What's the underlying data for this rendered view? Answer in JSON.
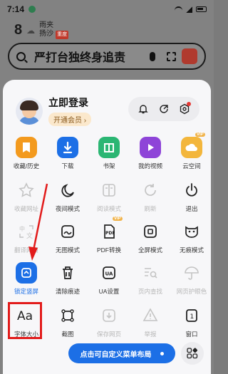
{
  "status": {
    "time": "7:14"
  },
  "weather": {
    "temp": "8",
    "condition": "雨夹",
    "city": "扬沙",
    "badge": "重度"
  },
  "search": {
    "query": "严打台独终身追责"
  },
  "profile": {
    "login": "立即登录",
    "vip": "开通会员 ›"
  },
  "menu": {
    "row1": [
      "收藏/历史",
      "下载",
      "书架",
      "我的视频",
      "云空间"
    ],
    "row2": [
      "收藏网址",
      "夜间模式",
      "阅读模式",
      "刷新",
      "退出"
    ],
    "row3": [
      "翻译网页",
      "无图模式",
      "PDF转换",
      "全屏模式",
      "无痕模式"
    ],
    "row4": [
      "锁定竖屏",
      "清除痕迹",
      "UA设置",
      "页内查找",
      "网页护眼色"
    ],
    "row5": [
      "字体大小",
      "截图",
      "保存网页",
      "举报",
      "窗口"
    ]
  },
  "badges": {
    "vip": "VIP",
    "ua": "UA",
    "aa": "Aa",
    "window_count": "1"
  },
  "custom_menu": "点击可自定义菜单布局",
  "colors": {
    "accent": "#1c6fe6",
    "highlight": "#e21b1b",
    "orange": "#f39a1e"
  }
}
